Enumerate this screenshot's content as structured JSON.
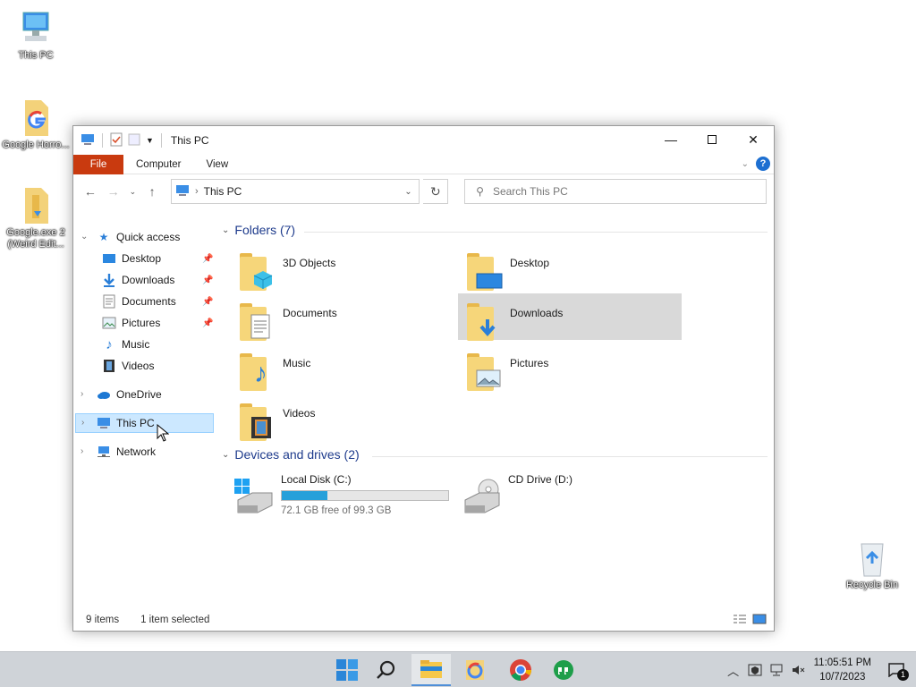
{
  "desktop": {
    "icons": [
      {
        "label": "This PC"
      },
      {
        "label": "Google Horro..."
      },
      {
        "label": "Google.exe 2 (Weird Edit..."
      },
      {
        "label": "Recycle Bin"
      }
    ]
  },
  "window": {
    "title": "This PC",
    "ribbon_tabs": [
      "File",
      "Computer",
      "View"
    ],
    "help_label": "?",
    "address": {
      "location": "This PC"
    },
    "search": {
      "placeholder": "Search This PC"
    }
  },
  "sidebar": {
    "quick_access": "Quick access",
    "items": [
      {
        "label": "Desktop",
        "pinned": true
      },
      {
        "label": "Downloads",
        "pinned": true
      },
      {
        "label": "Documents",
        "pinned": true
      },
      {
        "label": "Pictures",
        "pinned": true
      },
      {
        "label": "Music",
        "pinned": false
      },
      {
        "label": "Videos",
        "pinned": false
      }
    ],
    "onedrive": "OneDrive",
    "this_pc": "This PC",
    "network": "Network"
  },
  "content": {
    "folders_header": "Folders (7)",
    "folders": [
      {
        "label": "3D Objects"
      },
      {
        "label": "Desktop"
      },
      {
        "label": "Documents"
      },
      {
        "label": "Downloads",
        "selected": true
      },
      {
        "label": "Music"
      },
      {
        "label": "Pictures"
      },
      {
        "label": "Videos"
      }
    ],
    "drives_header": "Devices and drives (2)",
    "drives": [
      {
        "label": "Local Disk (C:)",
        "free_text": "72.1 GB free of 99.3 GB",
        "used_fraction": 0.274
      },
      {
        "label": "CD Drive (D:)"
      }
    ]
  },
  "status": {
    "items": "9 items",
    "selected": "1 item selected"
  },
  "taskbar": {
    "time": "11:05:51 PM",
    "date": "10/7/2023",
    "notification_count": "1"
  }
}
